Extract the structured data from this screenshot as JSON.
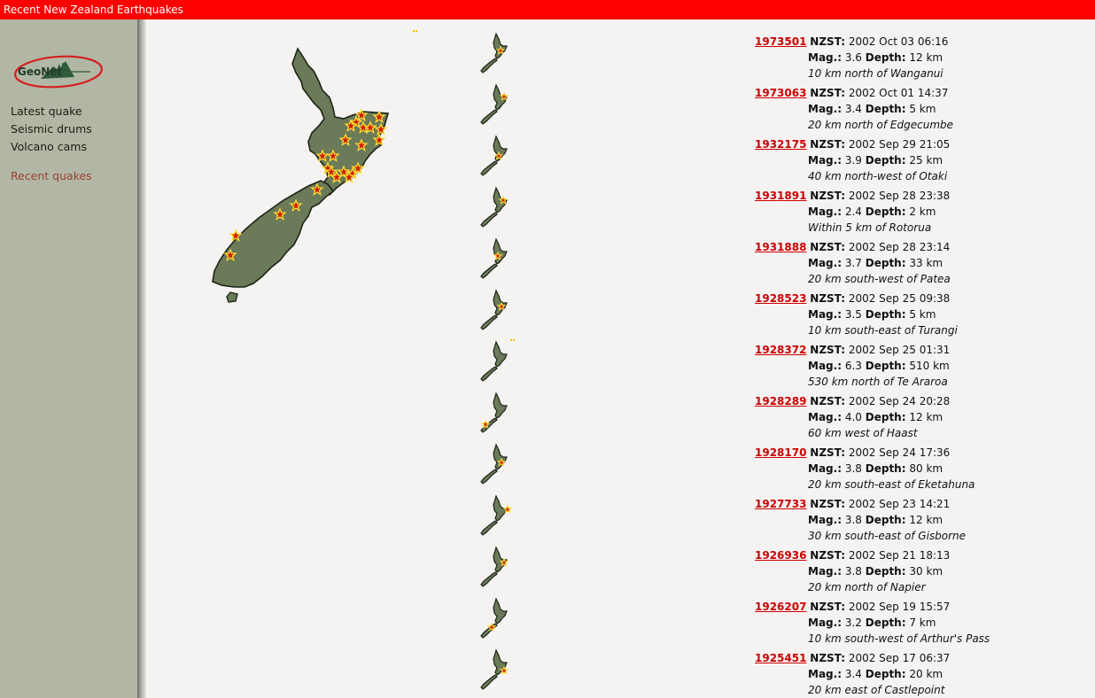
{
  "window": {
    "title": "Recent New Zealand Earthquakes"
  },
  "sidebar": {
    "logo_text": "GeoNet",
    "links": [
      {
        "label": "Latest quake"
      },
      {
        "label": "Seismic drums"
      },
      {
        "label": "Volcano cams"
      }
    ],
    "current": {
      "label": "Recent quakes"
    }
  },
  "labels": {
    "time_label": "NZST:",
    "mag_label": "Mag.:",
    "depth_label": "Depth:"
  },
  "colors": {
    "title_bar": "#ff0000",
    "sidebar": "#b1b7a4",
    "land": "#6b7a58",
    "star": "#cc2200",
    "star_outline": "#ffdd33",
    "link": "#cc0000"
  },
  "quakes": [
    {
      "id": "1973501",
      "time": "2002 Oct 03 06:16",
      "mag": "3.6",
      "depth": "12 km",
      "location": "10 km north of Wanganui"
    },
    {
      "id": "1973063",
      "time": "2002 Oct 01 14:37",
      "mag": "3.4",
      "depth": "5 km",
      "location": "20 km north of Edgecumbe"
    },
    {
      "id": "1932175",
      "time": "2002 Sep 29 21:05",
      "mag": "3.9",
      "depth": "25 km",
      "location": "40 km north-west of Otaki"
    },
    {
      "id": "1931891",
      "time": "2002 Sep 28 23:38",
      "mag": "2.4",
      "depth": "2 km",
      "location": "Within 5 km of Rotorua"
    },
    {
      "id": "1931888",
      "time": "2002 Sep 28 23:14",
      "mag": "3.7",
      "depth": "33 km",
      "location": "20 km south-west of Patea"
    },
    {
      "id": "1928523",
      "time": "2002 Sep 25 09:38",
      "mag": "3.5",
      "depth": "5 km",
      "location": "10 km south-east of Turangi"
    },
    {
      "id": "1928372",
      "time": "2002 Sep 25 01:31",
      "mag": "6.3",
      "depth": "510 km",
      "location": "530 km north of Te Araroa"
    },
    {
      "id": "1928289",
      "time": "2002 Sep 24 20:28",
      "mag": "4.0",
      "depth": "12 km",
      "location": "60 km west of Haast"
    },
    {
      "id": "1928170",
      "time": "2002 Sep 24 17:36",
      "mag": "3.8",
      "depth": "80 km",
      "location": "20 km south-east of Eketahuna"
    },
    {
      "id": "1927733",
      "time": "2002 Sep 23 14:21",
      "mag": "3.8",
      "depth": "12 km",
      "location": "30 km south-east of Gisborne"
    },
    {
      "id": "1926936",
      "time": "2002 Sep 21 18:13",
      "mag": "3.8",
      "depth": "30 km",
      "location": "20 km north of Napier"
    },
    {
      "id": "1926207",
      "time": "2002 Sep 19 15:57",
      "mag": "3.2",
      "depth": "7 km",
      "location": "10 km south-west of Arthur's Pass"
    },
    {
      "id": "1925451",
      "time": "2002 Sep 17 06:37",
      "mag": "3.4",
      "depth": "20 km",
      "location": "20 km east of Castlepoint"
    }
  ]
}
